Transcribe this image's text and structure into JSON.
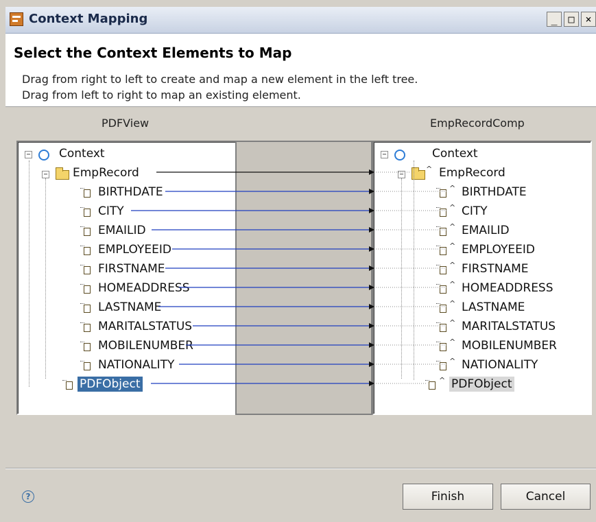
{
  "window": {
    "title": "Context Mapping",
    "controls": [
      "_",
      "□",
      "×"
    ]
  },
  "header": {
    "title": "Select the Context Elements to Map",
    "line1": "Drag from right to left to create and map a new element in the left tree.",
    "line2": "Drag from left to right to map an existing element."
  },
  "left": {
    "title": "PDFView",
    "root": "Context",
    "node": "EmpRecord",
    "attributes": [
      "BIRTHDATE",
      "CITY",
      "EMAILID",
      "EMPLOYEEID",
      "FIRSTNAME",
      "HOMEADDRESS",
      "LASTNAME",
      "MARITALSTATUS",
      "MOBILENUMBER",
      "NATIONALITY"
    ],
    "extra": "PDFObject"
  },
  "right": {
    "title": "EmpRecordComp",
    "root": "Context",
    "node": "EmpRecord",
    "attributes": [
      "BIRTHDATE",
      "CITY",
      "EMAILID",
      "EMPLOYEEID",
      "FIRSTNAME",
      "HOMEADDRESS",
      "LASTNAME",
      "MARITALSTATUS",
      "MOBILENUMBER",
      "NATIONALITY"
    ],
    "extra": "PDFObject",
    "caret": "^"
  },
  "colors": {
    "mapping_line": "#1f3fbf",
    "selection": "#3a6ea5"
  },
  "buttons": {
    "finish": "Finish",
    "cancel": "Cancel",
    "help": "?"
  }
}
